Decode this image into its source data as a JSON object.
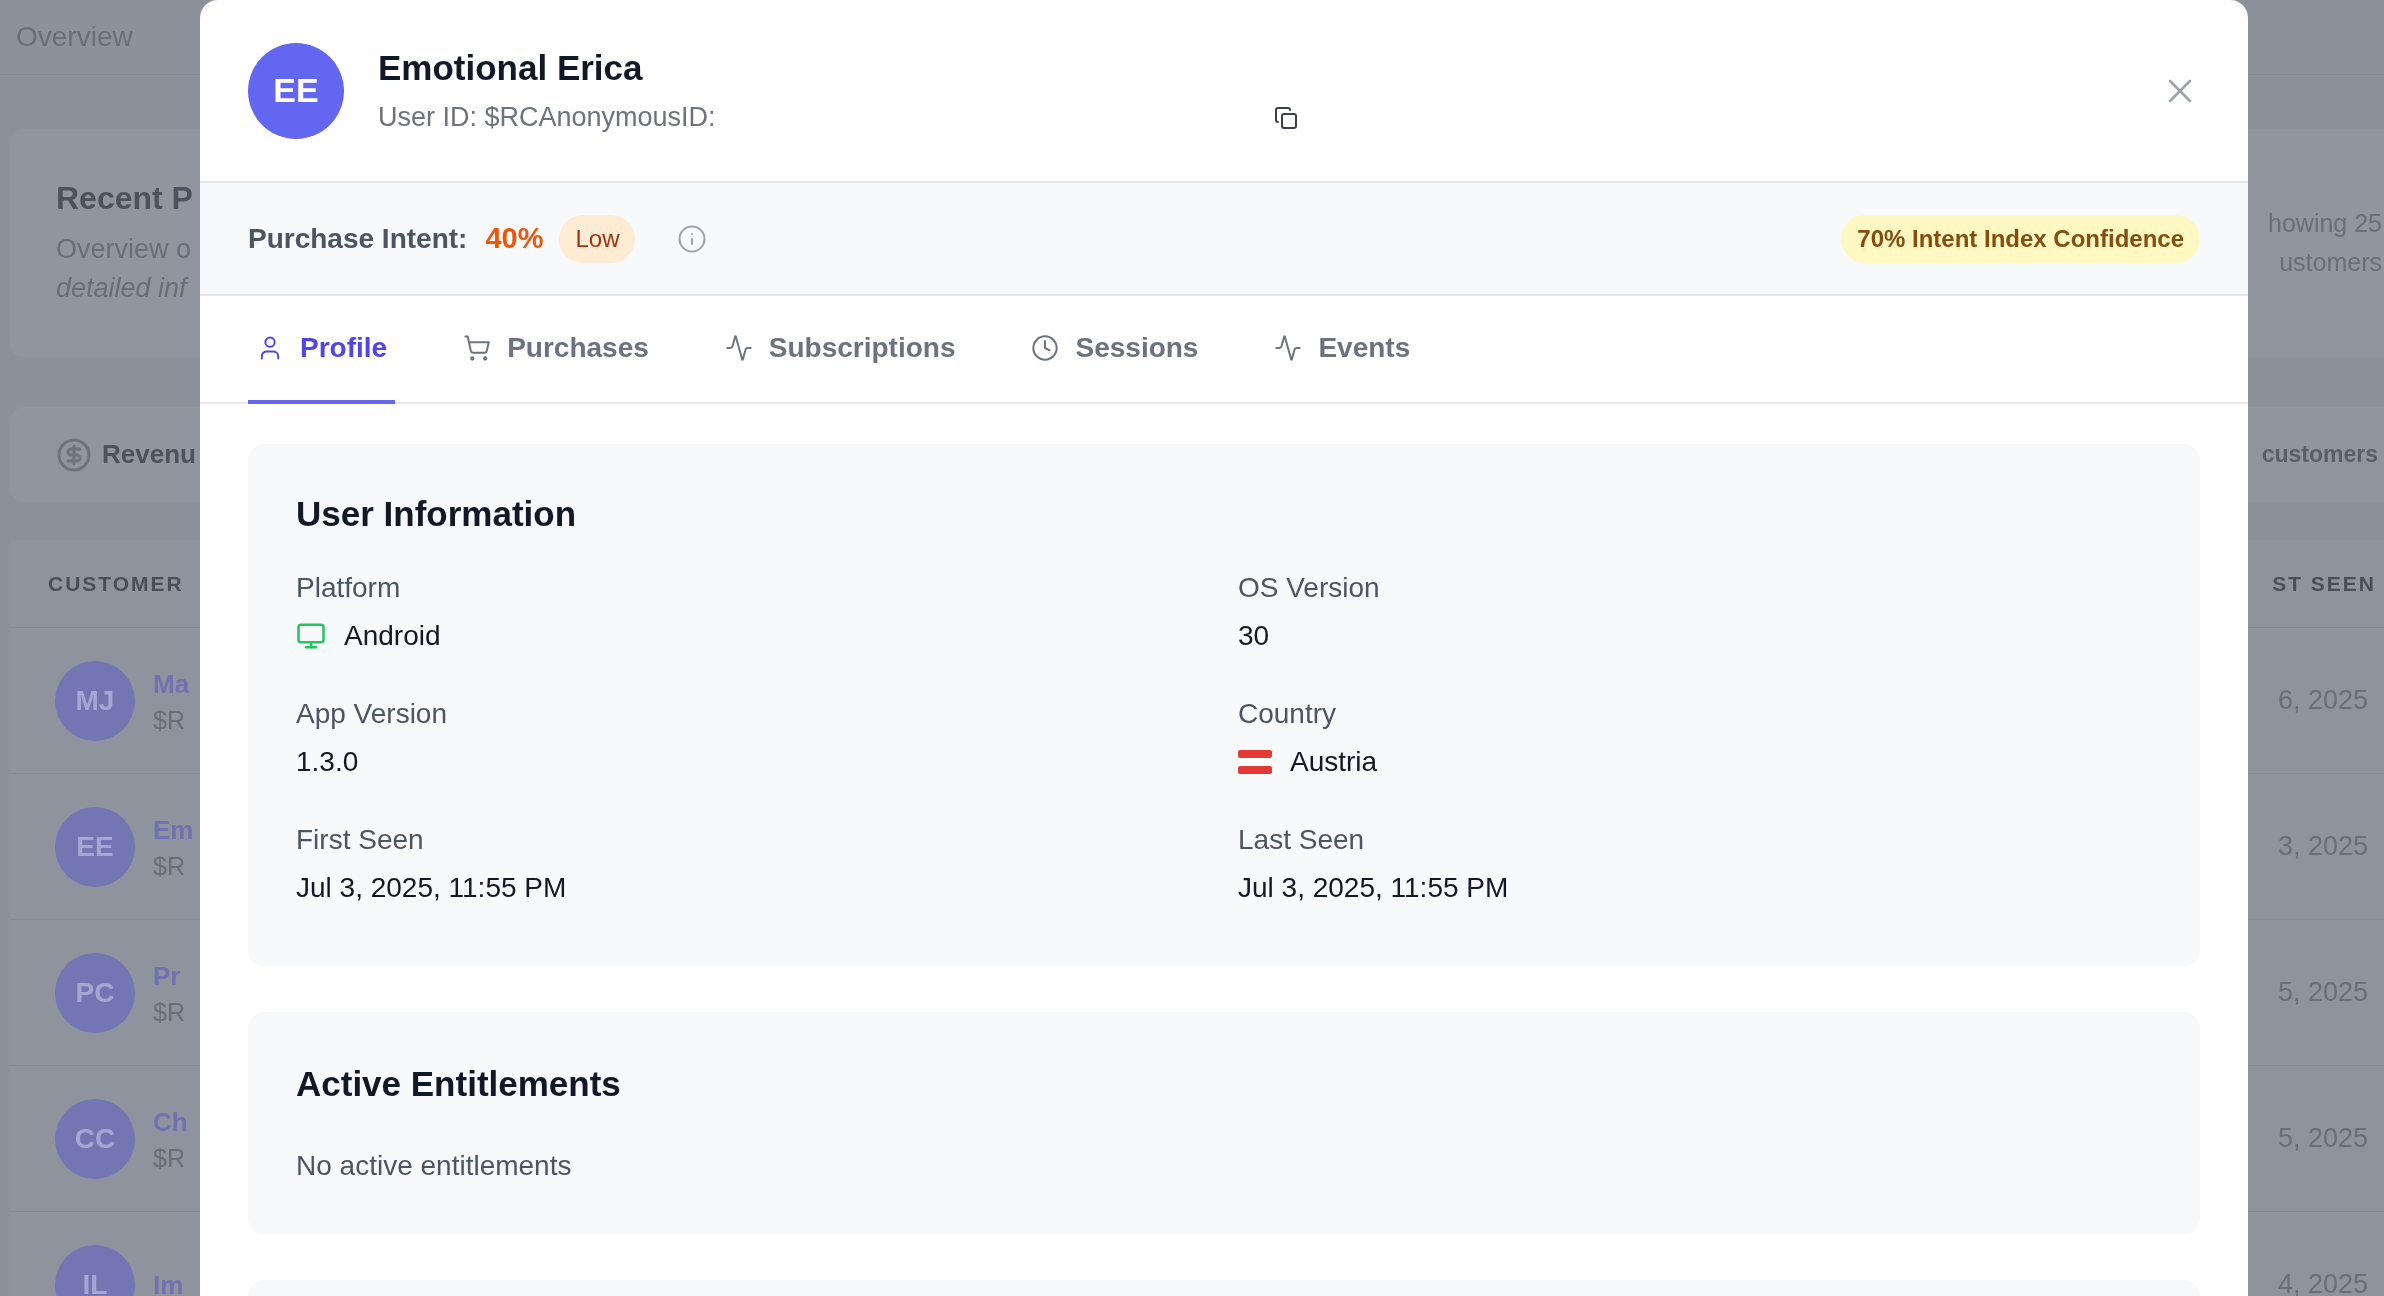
{
  "background": {
    "page_title": "Overview",
    "intro_card": {
      "title": "Recent P",
      "subtitle": "Overview o",
      "note": "detailed inf",
      "count_line_1": "howing 25",
      "count_line_2": "ustomers"
    },
    "revenue_bar": {
      "label": "Revenu",
      "count": "customers"
    },
    "table": {
      "columns": [
        "CUSTOMER",
        "ST SEEN"
      ],
      "rows": [
        {
          "initials": "MJ",
          "name": "Ma",
          "id": "$R",
          "last_seen": "6, 2025"
        },
        {
          "initials": "EE",
          "name": "Em",
          "id": "$R",
          "last_seen": "3, 2025"
        },
        {
          "initials": "PC",
          "name": "Pr",
          "id": "$R",
          "last_seen": "5, 2025"
        },
        {
          "initials": "CC",
          "name": "Ch",
          "id": "$R",
          "last_seen": "5, 2025"
        },
        {
          "initials": "IL",
          "name": "Im",
          "last_seen": "4, 2025"
        }
      ]
    }
  },
  "modal": {
    "user": {
      "initials": "EE",
      "name": "Emotional Erica",
      "user_id": "User ID: $RCAnonymousID:"
    },
    "purchase_intent": {
      "label": "Purchase Intent:",
      "value": "40%",
      "rating": "Low",
      "confidence": "70% Intent Index Confidence"
    },
    "tabs": [
      {
        "label": "Profile",
        "kind": "user",
        "selected": true
      },
      {
        "label": "Purchases",
        "kind": "cart",
        "selected": false
      },
      {
        "label": "Subscriptions",
        "kind": "activity",
        "selected": false
      },
      {
        "label": "Sessions",
        "kind": "clock",
        "selected": false
      },
      {
        "label": "Events",
        "kind": "activity",
        "selected": false
      }
    ],
    "user_information": {
      "title": "User Information",
      "fields": [
        {
          "label": "Platform",
          "value": "Android",
          "kind": "platform"
        },
        {
          "label": "OS Version",
          "value": "30",
          "kind": "text"
        },
        {
          "label": "App Version",
          "value": "1.3.0",
          "kind": "text"
        },
        {
          "label": "Country",
          "value": "Austria",
          "kind": "country"
        },
        {
          "label": "First Seen",
          "value": "Jul 3, 2025, 11:55 PM",
          "kind": "text"
        },
        {
          "label": "Last Seen",
          "value": "Jul 3, 2025, 11:55 PM",
          "kind": "text"
        }
      ]
    },
    "active_entitlements": {
      "title": "Active Entitlements",
      "empty_text": "No active entitlements"
    }
  }
}
